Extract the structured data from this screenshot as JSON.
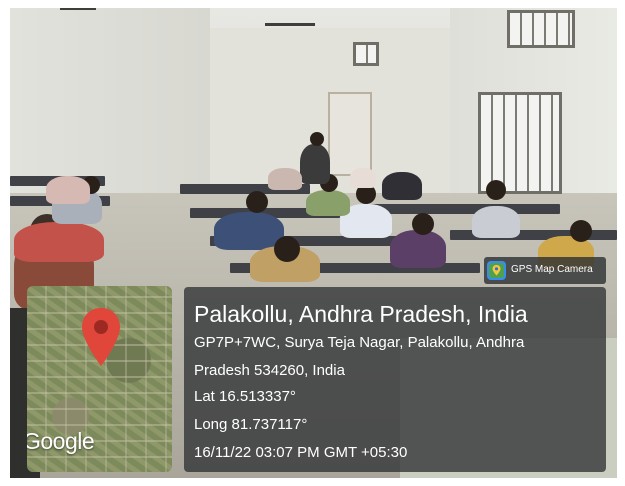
{
  "badge": {
    "label": "GPS Map Camera",
    "icon": "gps-map-camera-icon"
  },
  "map": {
    "brand": "Google",
    "pin_color": "#e0463a"
  },
  "location": {
    "place": "Palakollu, Andhra Pradesh, India",
    "address_line1": "GP7P+7WC, Surya Teja Nagar, Palakollu, Andhra",
    "address_line2": "Pradesh 534260, India",
    "latitude": "Lat 16.513337°",
    "longitude": "Long 81.737117°",
    "timestamp": "16/11/22 03:07 PM GMT +05:30"
  }
}
